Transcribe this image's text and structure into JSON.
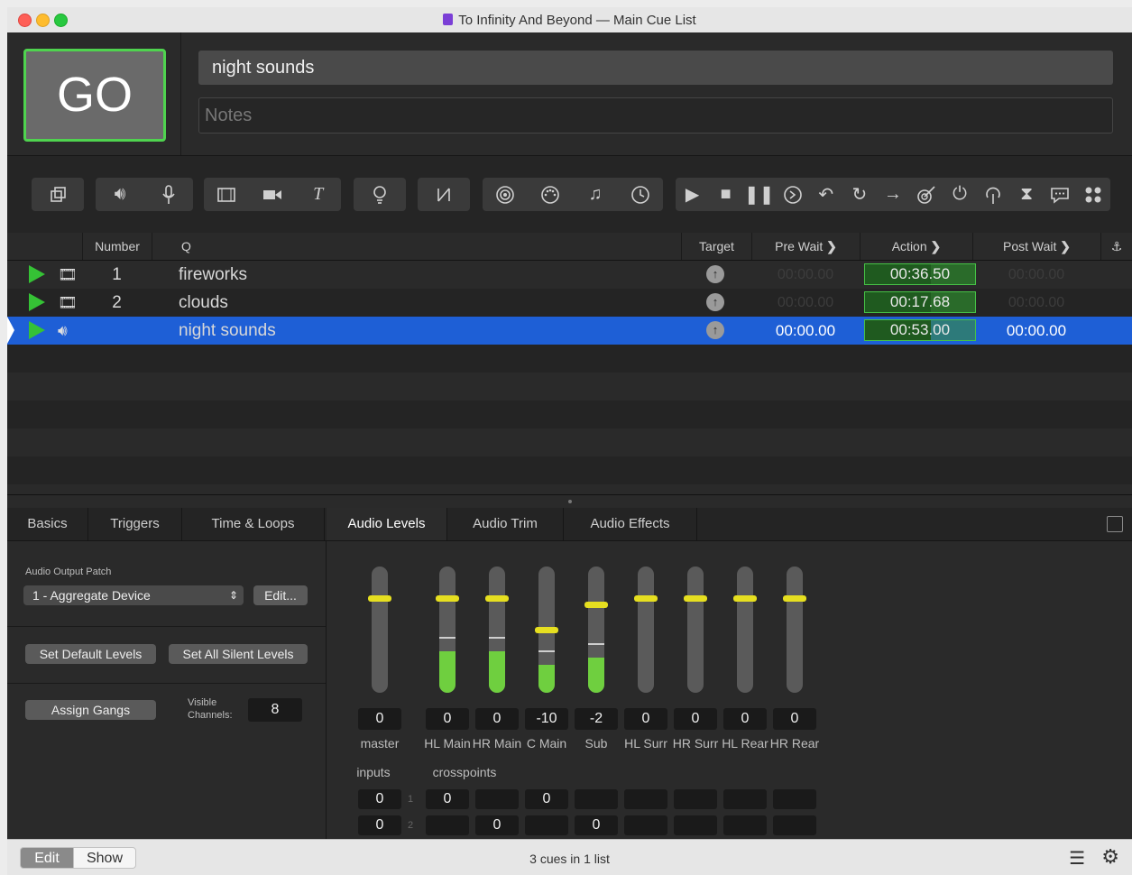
{
  "window": {
    "title": "To Infinity And Beyond — Main Cue List"
  },
  "go_button": "GO",
  "cue_name": "night sounds",
  "notes": {
    "placeholder": "Notes"
  },
  "toolbar": {
    "groups": [
      [
        "group-cue-icon"
      ],
      [
        "audio-cue-icon",
        "mic-cue-icon"
      ],
      [
        "video-cue-icon",
        "camera-cue-icon",
        "text-cue-icon"
      ],
      [
        "light-cue-icon"
      ],
      [
        "network-cue-icon"
      ],
      [
        "fade-cue-icon",
        "midi-cue-icon",
        "music-cue-icon",
        "timecode-cue-icon"
      ],
      [
        "start-cue-icon",
        "stop-cue-icon",
        "pause-cue-icon",
        "load-cue-icon",
        "reset-cue-icon",
        "devamp-cue-icon",
        "goto-cue-icon",
        "target-cue-icon",
        "arm-cue-icon",
        "disarm-cue-icon",
        "wait-cue-icon",
        "memo-cue-icon",
        "script-cue-icon"
      ]
    ]
  },
  "table": {
    "headers": {
      "number": "Number",
      "q": "Q",
      "target": "Target",
      "pre_wait": "Pre Wait",
      "action": "Action",
      "post_wait": "Post Wait"
    },
    "rows": [
      {
        "number": "1",
        "name": "fireworks",
        "type": "video-icon",
        "pre_wait": "00:00.00",
        "action": "00:36.50",
        "post_wait": "00:00.00",
        "selected": false,
        "progress": 0.6
      },
      {
        "number": "2",
        "name": "clouds",
        "type": "video-icon",
        "pre_wait": "00:00.00",
        "action": "00:17.68",
        "post_wait": "00:00.00",
        "selected": false,
        "progress": 0.6
      },
      {
        "number": "",
        "name": "night sounds",
        "type": "audio-icon",
        "pre_wait": "00:00.00",
        "action": "00:53.00",
        "post_wait": "00:00.00",
        "selected": true,
        "progress": 0.6
      }
    ]
  },
  "inspector": {
    "tabs": [
      "Basics",
      "Triggers",
      "Time & Loops",
      "Audio Levels",
      "Audio Trim",
      "Audio Effects"
    ],
    "active_tab": "Audio Levels",
    "audio_output_patch_label": "Audio Output Patch",
    "patch_value": "1 - Aggregate Device",
    "edit_button": "Edit...",
    "set_default_levels": "Set Default Levels",
    "set_all_silent_levels": "Set All Silent Levels",
    "assign_gangs": "Assign Gangs",
    "visible_channels_label_1": "Visible",
    "visible_channels_label_2": "Channels:",
    "visible_channels_value": "8",
    "faders": [
      {
        "value": "0",
        "label": "master",
        "fill": 0.0,
        "knob": 0.75
      },
      {
        "value": "0",
        "label": "HL Main",
        "fill": 0.33,
        "knob": 0.75
      },
      {
        "value": "0",
        "label": "HR Main",
        "fill": 0.33,
        "knob": 0.75
      },
      {
        "value": "-10",
        "label": "C Main",
        "fill": 0.22,
        "knob": 0.5
      },
      {
        "value": "-2",
        "label": "Sub",
        "fill": 0.28,
        "knob": 0.7
      },
      {
        "value": "0",
        "label": "HL Surr",
        "fill": 0.0,
        "knob": 0.75
      },
      {
        "value": "0",
        "label": "HR Surr",
        "fill": 0.0,
        "knob": 0.75
      },
      {
        "value": "0",
        "label": "HL Rear",
        "fill": 0.0,
        "knob": 0.75
      },
      {
        "value": "0",
        "label": "HR Rear",
        "fill": 0.0,
        "knob": 0.75
      }
    ],
    "inputs_label": "inputs",
    "crosspoints_label": "crosspoints",
    "input_rows": [
      {
        "num": "1",
        "input": "0",
        "cells": [
          "0",
          "",
          "0",
          "",
          "",
          "",
          "",
          ""
        ]
      },
      {
        "num": "2",
        "input": "0",
        "cells": [
          "",
          "0",
          "",
          "0",
          "",
          "",
          "",
          ""
        ]
      }
    ]
  },
  "bottom": {
    "edit": "Edit",
    "show": "Show",
    "status": "3 cues in 1 list"
  }
}
